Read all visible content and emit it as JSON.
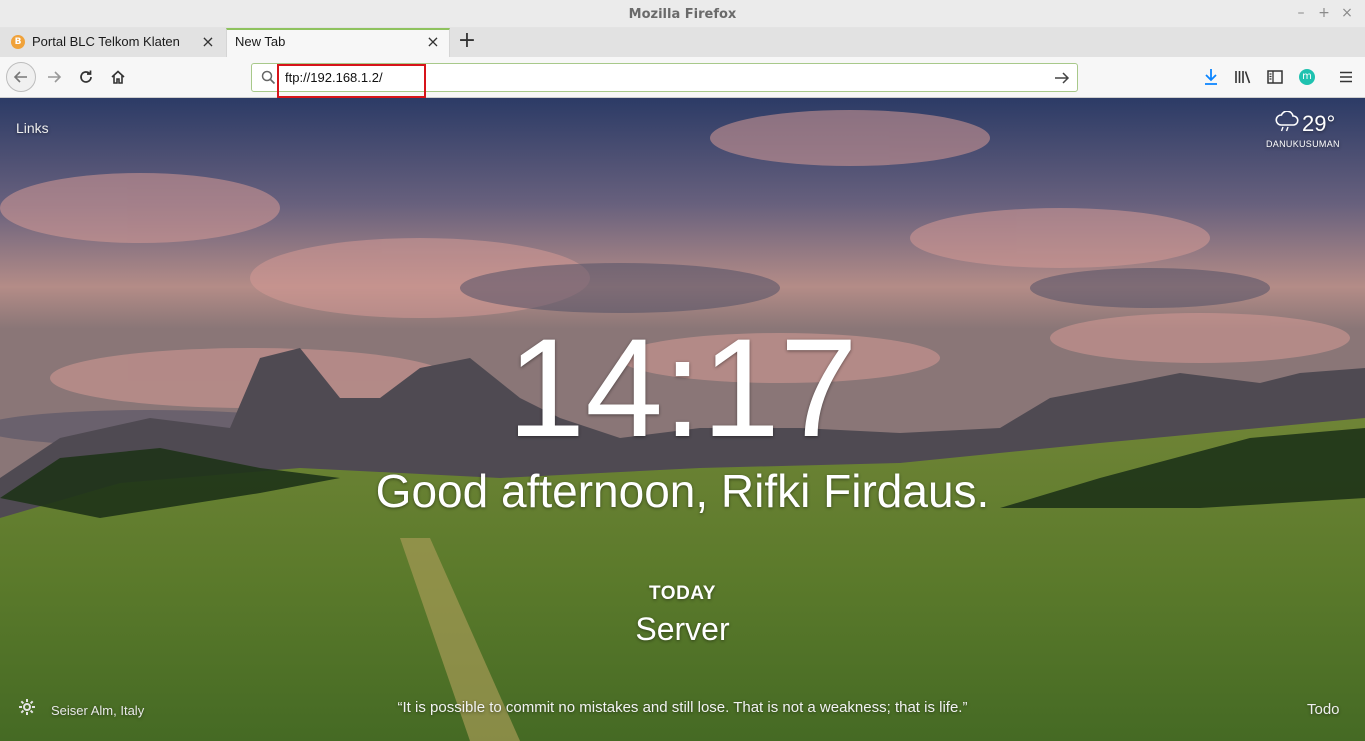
{
  "window": {
    "title": "Mozilla Firefox"
  },
  "tabs": [
    {
      "label": "Portal BLC Telkom Klaten",
      "favicon_letter": "B"
    },
    {
      "label": "New Tab"
    }
  ],
  "navbar": {
    "url": "ftp://192.168.1.2/",
    "account_letter": "m"
  },
  "content": {
    "links_label": "Links",
    "weather": {
      "temp": "29°",
      "location": "DANUKUSUMAN"
    },
    "clock": "14:17",
    "greeting": "Good afternoon, Rifki Firdaus.",
    "today_label": "TODAY",
    "focus": "Server",
    "photo_location": "Seiser Alm, Italy",
    "quote": "“It is possible to commit no mistakes and still lose. That is not a weakness; that is life.”",
    "todo_label": "Todo"
  },
  "colors": {
    "accent_green": "#8ec25e",
    "highlight_red": "#d7141a",
    "download_blue": "#0a84ff",
    "account_teal": "#1fc2b0"
  }
}
